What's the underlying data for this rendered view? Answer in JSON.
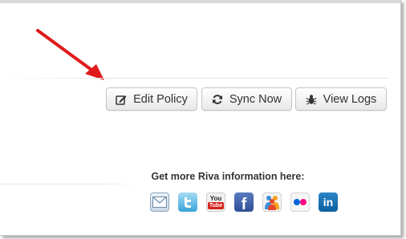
{
  "toolbar": {
    "edit_policy_label": "Edit Policy",
    "sync_now_label": "Sync Now",
    "view_logs_label": "View Logs"
  },
  "footer": {
    "info_text": "Get more Riva information here:",
    "social_icons": [
      "mail-icon",
      "twitter-icon",
      "youtube-icon",
      "facebook-icon",
      "delicious-icon",
      "flickr-icon",
      "linkedin-icon"
    ],
    "youtube_top": "You",
    "youtube_bottom": "Tube",
    "facebook_glyph": "f",
    "linkedin_glyph": "in"
  },
  "colors": {
    "arrow": "#e01b1b",
    "button_text": "#333333",
    "twitter": "#3aa3d8",
    "facebook": "#3b5998",
    "linkedin": "#0e76a8",
    "youtube_red": "#d6231b"
  }
}
